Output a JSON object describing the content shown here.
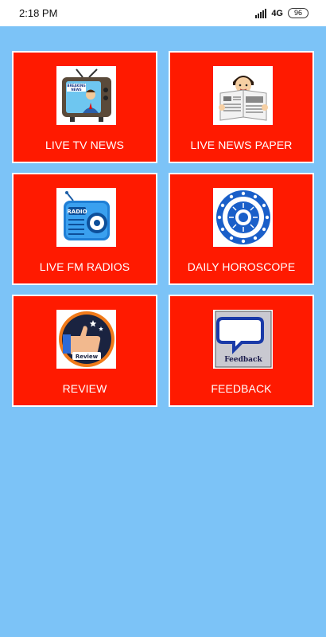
{
  "status": {
    "time": "2:18 PM",
    "network": "4G",
    "battery": "96"
  },
  "tiles": [
    {
      "label": "LIVE TV NEWS",
      "icon": "tv-news-icon"
    },
    {
      "label": "LIVE NEWS PAPER",
      "icon": "newspaper-reader-icon"
    },
    {
      "label": "LIVE FM RADIOS",
      "icon": "radio-icon"
    },
    {
      "label": "DAILY HOROSCOPE",
      "icon": "zodiac-wheel-icon"
    },
    {
      "label": "REVIEW",
      "icon": "thumbs-up-review-icon",
      "caption": "Review"
    },
    {
      "label": "FEEDBACK",
      "icon": "feedback-chat-icon",
      "caption": "Feedback"
    }
  ],
  "tv_screen_text": "BREAKING NEWS",
  "radio_text": "RADIO",
  "colors": {
    "background": "#7cc3f7",
    "tile": "#ff1a00",
    "status_bar": "#ffffff"
  }
}
